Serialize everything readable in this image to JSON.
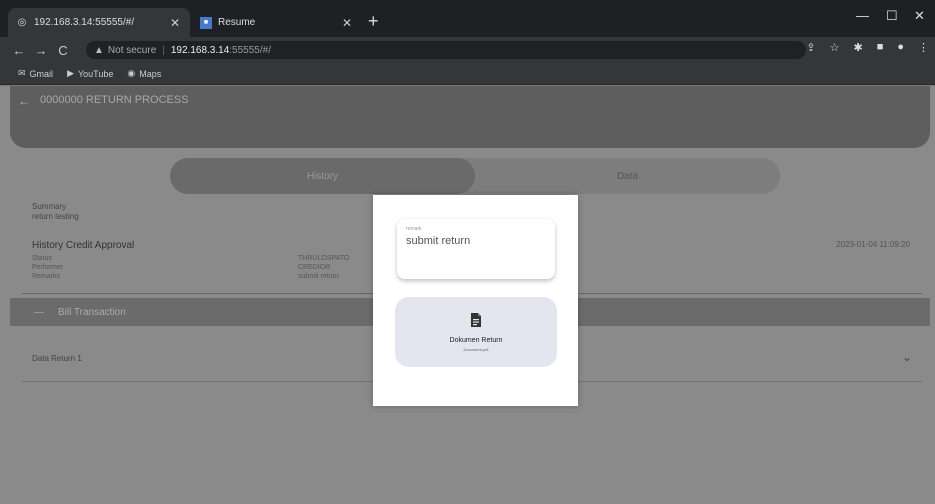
{
  "browser": {
    "tabs": [
      {
        "title": "192.168.3.14:55555/#/",
        "icon": "globe-icon",
        "active": true
      },
      {
        "title": "Resume",
        "icon": "page-icon",
        "active": false
      }
    ],
    "new_tab_icon": "+",
    "window_controls": {
      "minimize": "—",
      "maximize": "☐",
      "close": "✕"
    },
    "toolbar": {
      "back": "←",
      "forward": "→",
      "reload": "C",
      "security_icon": "▲",
      "security_text": "Not secure",
      "url_host": "192.168.3.14",
      "url_path": ":55555/#/"
    },
    "bookmarks": [
      {
        "label": "Gmail",
        "icon": "gmail-icon"
      },
      {
        "label": "YouTube",
        "icon": "youtube-icon"
      },
      {
        "label": "Maps",
        "icon": "maps-icon"
      }
    ]
  },
  "app": {
    "header_title": "0000000 RETURN PROCESS",
    "back_icon": "←",
    "segment": {
      "left": "History",
      "right": "Data"
    },
    "summary": {
      "label": "Summary",
      "value": "return testing"
    },
    "history": {
      "title": "History Credit Approval",
      "date": "2023-01-04 11:09:20",
      "keys": [
        "Status",
        "Performer",
        "Remarks"
      ],
      "values": [
        "THRULOSPATO",
        "CREDIOR",
        "submit return"
      ]
    },
    "section": {
      "icon": "—",
      "title": "Bill Transaction"
    },
    "data_row": {
      "label": "Data Return 1",
      "chevron": "⌄"
    }
  },
  "modal": {
    "note_label": "remark",
    "note_value": "submit return",
    "document_button": {
      "title": "Dokumen Return",
      "subtitle": "Document.pdf",
      "icon": "document-icon"
    }
  }
}
